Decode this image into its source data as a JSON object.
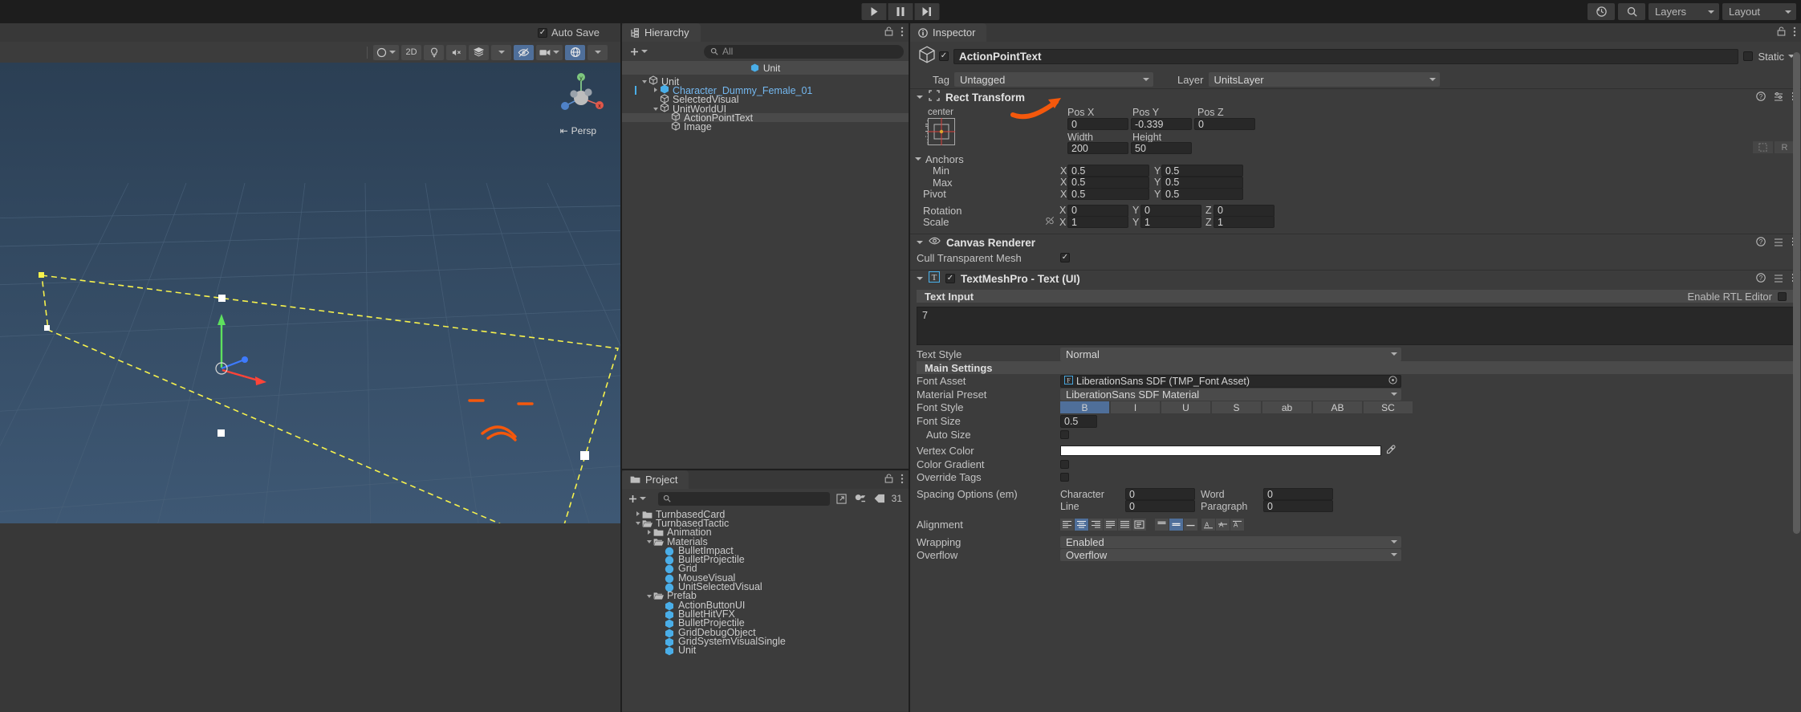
{
  "topbar": {
    "play_icon": "play-icon",
    "pause_icon": "pause-icon",
    "step_icon": "step-icon",
    "history_icon": "history-icon",
    "search_icon": "search-icon",
    "layers_label": "Layers",
    "layout_label": "Layout"
  },
  "scene": {
    "autosave_label": "Auto Save",
    "autosave_checked": "✓",
    "toolbar": {
      "shading_icon": "shading-sphere-icon",
      "twod_label": "2D",
      "lighting_icon": "lighting-icon",
      "audio_icon": "audio-mute-icon",
      "fx_icon": "effects-icon",
      "visibility_icon": "visibility-off-icon",
      "camera_icon": "camera-icon",
      "gizmos_icon": "gizmos-icon"
    },
    "persp_label": "Persp",
    "gizmo_x": "x",
    "gizmo_y": "y",
    "gizmo_z": "z"
  },
  "hierarchy": {
    "tab_label": "Hierarchy",
    "tab_icon": "hierarchy-icon",
    "lock_icon": "lock-icon",
    "menu_icon": "kebab-menu-icon",
    "add_icon": "plus-icon",
    "search_placeholder": "All",
    "search_icon": "search-icon",
    "breadcrumb": "Unit",
    "items": [
      {
        "label": "Unit",
        "depth": 1,
        "arrow": "down",
        "selected": false,
        "blue": false
      },
      {
        "label": "Character_Dummy_Female_01",
        "depth": 2,
        "arrow": "right",
        "selected": false,
        "blue": true
      },
      {
        "label": "SelectedVisual",
        "depth": 2,
        "arrow": "none",
        "selected": false,
        "blue": false
      },
      {
        "label": "UnitWorldUI",
        "depth": 2,
        "arrow": "down",
        "selected": false,
        "blue": false
      },
      {
        "label": "ActionPointText",
        "depth": 3,
        "arrow": "none",
        "selected": true,
        "blue": false
      },
      {
        "label": "Image",
        "depth": 3,
        "arrow": "none",
        "selected": false,
        "blue": false
      }
    ]
  },
  "project": {
    "tab_label": "Project",
    "tab_icon": "folder-icon",
    "lock_icon": "lock-icon",
    "menu_icon": "kebab-menu-icon",
    "add_icon": "plus-icon",
    "search_icon": "search-icon",
    "search_placeholder": "",
    "count_badge": "31",
    "toolbar_icons": [
      "expand-icon",
      "filter-type-icon",
      "filter-label-icon"
    ],
    "items": [
      {
        "label": "TurnbasedCard",
        "depth": 1,
        "arrow": "right",
        "kind": "folder"
      },
      {
        "label": "TurnbasedTactic",
        "depth": 1,
        "arrow": "down",
        "kind": "folder-open"
      },
      {
        "label": "Animation",
        "depth": 2,
        "arrow": "right",
        "kind": "folder"
      },
      {
        "label": "Materials",
        "depth": 2,
        "arrow": "down",
        "kind": "folder-open"
      },
      {
        "label": "BulletImpact",
        "depth": 3,
        "arrow": "none",
        "kind": "material"
      },
      {
        "label": "BulletProjectile",
        "depth": 3,
        "arrow": "none",
        "kind": "material"
      },
      {
        "label": "Grid",
        "depth": 3,
        "arrow": "none",
        "kind": "material"
      },
      {
        "label": "MouseVisual",
        "depth": 3,
        "arrow": "none",
        "kind": "material"
      },
      {
        "label": "UnitSelectedVisual",
        "depth": 3,
        "arrow": "none",
        "kind": "material"
      },
      {
        "label": "Prefab",
        "depth": 2,
        "arrow": "down",
        "kind": "folder-open"
      },
      {
        "label": "ActionButtonUI",
        "depth": 3,
        "arrow": "none",
        "kind": "prefab"
      },
      {
        "label": "BulletHitVFX",
        "depth": 3,
        "arrow": "none",
        "kind": "prefab"
      },
      {
        "label": "BulletProjectile",
        "depth": 3,
        "arrow": "none",
        "kind": "prefab"
      },
      {
        "label": "GridDebugObject",
        "depth": 3,
        "arrow": "none",
        "kind": "prefab"
      },
      {
        "label": "GridSystemVisualSingle",
        "depth": 3,
        "arrow": "none",
        "kind": "prefab"
      },
      {
        "label": "Unit",
        "depth": 3,
        "arrow": "none",
        "kind": "prefab"
      }
    ]
  },
  "inspector": {
    "tab_label": "Inspector",
    "tab_icon": "info-icon",
    "lock_icon": "lock-icon",
    "menu_icon": "kebab-menu-icon",
    "object": {
      "enabled": "✓",
      "name": "ActionPointText",
      "static_label": "Static",
      "static_checked": false,
      "tag_label": "Tag",
      "tag_value": "Untagged",
      "layer_label": "Layer",
      "layer_value": "UnitsLayer",
      "cube_icon": "gameobject-cube-icon"
    },
    "rect_transform": {
      "title": "Rect Transform",
      "icon": "rect-transform-icon",
      "help_icon": "help-icon",
      "preset_icon": "preset-icon",
      "menu_icon": "kebab-menu-icon",
      "anchor_preset_top": "center",
      "anchor_preset_side": "middle",
      "pos_x_label": "Pos X",
      "pos_x": "0",
      "pos_y_label": "Pos Y",
      "pos_y": "-0.339",
      "pos_z_label": "Pos Z",
      "pos_z": "0",
      "width_label": "Width",
      "width": "200",
      "height_label": "Height",
      "height": "50",
      "blueprint_icon": "blueprint-mode-icon",
      "raw_label": "R",
      "anchors_label": "Anchors",
      "min_label": "Min",
      "min_x": "0.5",
      "min_y": "0.5",
      "max_label": "Max",
      "max_x": "0.5",
      "max_y": "0.5",
      "pivot_label": "Pivot",
      "pivot_x": "0.5",
      "pivot_y": "0.5",
      "rotation_label": "Rotation",
      "rot_x": "0",
      "rot_y": "0",
      "rot_z": "0",
      "scale_label": "Scale",
      "scale_x": "1",
      "scale_y": "1",
      "scale_z": "1",
      "scale_link_icon": "link-broken-icon",
      "axis_x": "X",
      "axis_y": "Y",
      "axis_z": "Z"
    },
    "canvas_renderer": {
      "title": "Canvas Renderer",
      "icon": "eye-icon",
      "cull_label": "Cull Transparent Mesh",
      "cull_checked": "✓"
    },
    "tmp": {
      "title": "TextMeshPro - Text (UI)",
      "icon": "tmp-T-icon",
      "enabled": "✓",
      "text_input_label": "Text Input",
      "rtl_label": "Enable RTL Editor",
      "text_value": "7",
      "text_style_label": "Text Style",
      "text_style_value": "Normal",
      "main_settings_label": "Main Settings",
      "font_asset_label": "Font Asset",
      "font_asset_value": "LiberationSans SDF (TMP_Font Asset)",
      "font_asset_icon": "font-asset-F-icon",
      "font_asset_picker_icon": "object-picker-icon",
      "material_preset_label": "Material Preset",
      "material_preset_value": "LiberationSans SDF Material",
      "font_style_label": "Font Style",
      "font_style_buttons": [
        {
          "label": "B",
          "active": true
        },
        {
          "label": "I",
          "active": false
        },
        {
          "label": "U",
          "active": false
        },
        {
          "label": "S",
          "active": false
        },
        {
          "label": "ab",
          "active": false
        },
        {
          "label": "AB",
          "active": false
        },
        {
          "label": "SC",
          "active": false
        }
      ],
      "font_size_label": "Font Size",
      "font_size_value": "0.5",
      "auto_size_label": "Auto Size",
      "auto_size_checked": false,
      "vertex_color_label": "Vertex Color",
      "vertex_color_value": "#ffffff",
      "eyedropper_icon": "eyedropper-icon",
      "color_gradient_label": "Color Gradient",
      "color_gradient_checked": false,
      "override_tags_label": "Override Tags",
      "override_tags_checked": false,
      "spacing_label": "Spacing Options (em)",
      "spacing_character_label": "Character",
      "spacing_character": "0",
      "spacing_word_label": "Word",
      "spacing_word": "0",
      "spacing_line_label": "Line",
      "spacing_line": "0",
      "spacing_paragraph_label": "Paragraph",
      "spacing_paragraph": "0",
      "alignment_label": "Alignment",
      "alignment_h": [
        "align-left-icon",
        "align-center-icon",
        "align-right-icon",
        "align-justify-icon",
        "align-flush-icon",
        "align-geometry-icon"
      ],
      "alignment_h_active": 1,
      "alignment_v": [
        "align-top-icon",
        "align-middle-icon",
        "align-bottom-icon",
        "align-baseline-icon",
        "align-midline-icon",
        "align-capline-icon"
      ],
      "alignment_v_active": 1,
      "wrapping_label": "Wrapping",
      "wrapping_value": "Enabled",
      "overflow_label": "Overflow",
      "overflow_value": "Overflow"
    }
  },
  "annotation": {
    "color": "#f4580c",
    "target": "width-field"
  }
}
